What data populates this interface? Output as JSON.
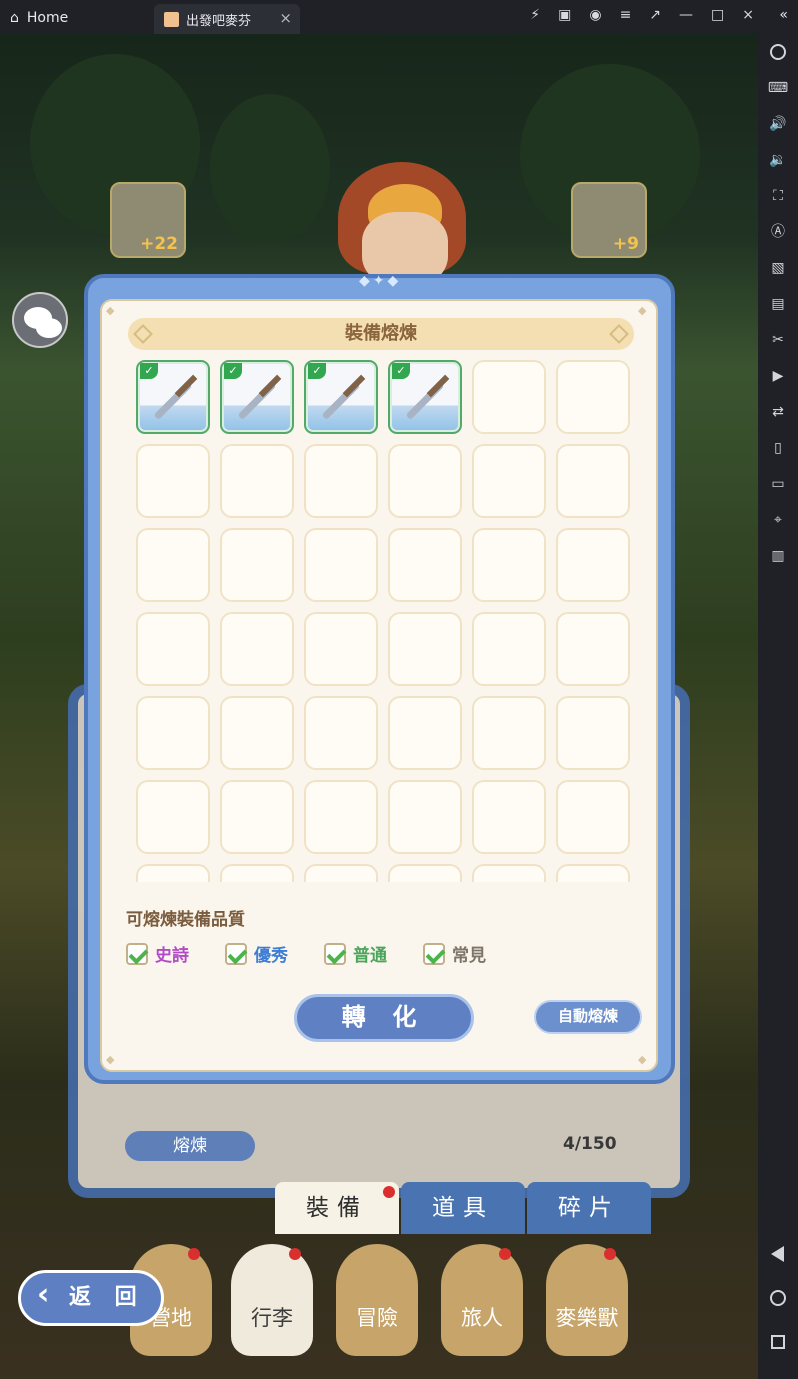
{
  "window": {
    "home_tab": "Home",
    "game_tab": "出發吧麥芬"
  },
  "game": {
    "top_equipment": [
      {
        "level": "+22"
      },
      {
        "level": "+9"
      }
    ],
    "modal": {
      "title": "裝備熔煉",
      "grid_total_visible_rows": 6,
      "filled_items": 4,
      "quality_section_title": "可熔煉裝備品質",
      "qualities": [
        {
          "label": "史詩",
          "checked": true,
          "color": "#b34bc8"
        },
        {
          "label": "優秀",
          "checked": true,
          "color": "#3e7dd5"
        },
        {
          "label": "普通",
          "checked": true,
          "color": "#4ca55c"
        },
        {
          "label": "常見",
          "checked": true,
          "color": "#7e7467"
        }
      ],
      "convert_button": "轉 化",
      "auto_smelt_button": "自動熔煉"
    },
    "background_panel": {
      "smelt_button": "熔煉",
      "capacity": "4/150"
    },
    "tabs": [
      {
        "label": "裝備"
      },
      {
        "label": "道具"
      },
      {
        "label": "碎片"
      }
    ],
    "bottom_nav": [
      {
        "label": "營地"
      },
      {
        "label": "行李"
      },
      {
        "label": "冒險"
      },
      {
        "label": "旅人"
      },
      {
        "label": "麥樂獸"
      }
    ],
    "return_button": "返 回"
  }
}
